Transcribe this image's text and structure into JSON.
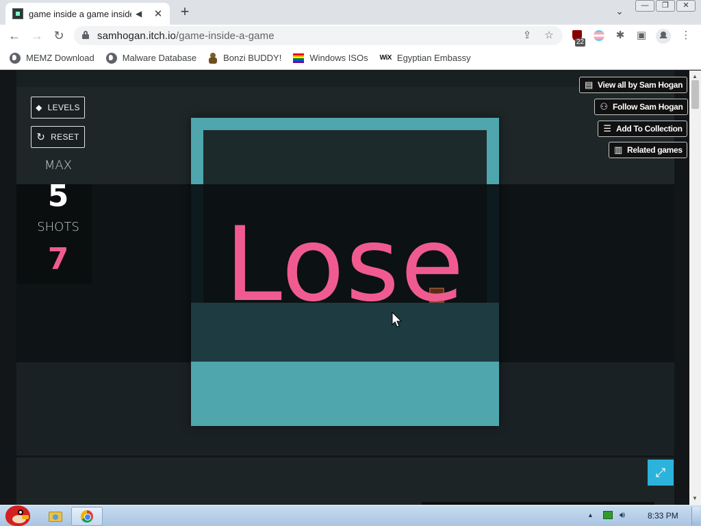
{
  "browser": {
    "tab": {
      "title": "game inside a game inside",
      "audio_icon": "speaker-icon",
      "close_label": "✕"
    },
    "new_tab_label": "+",
    "tab_search_label": "⌄",
    "window_controls": [
      "—",
      "❐",
      "✕"
    ],
    "address": {
      "domain": "samhogan.itch.io",
      "path": "/game-inside-a-game"
    },
    "extension_badge": "22",
    "bookmarks": [
      {
        "label": "MEMZ Download",
        "icon": "globe-icon"
      },
      {
        "label": "Malware Database",
        "icon": "globe-icon"
      },
      {
        "label": "Bonzi BUDDY!",
        "icon": "bonzi-icon"
      },
      {
        "label": "Windows ISOs",
        "icon": "rainbow-flag-icon"
      },
      {
        "label": "Egyptian Embassy",
        "icon": "wix-icon"
      }
    ]
  },
  "game": {
    "levels_label": "LEVELS",
    "reset_label": "RESET",
    "max_label": "MAX",
    "max_value": "5",
    "shots_label": "SHOTS",
    "shots_value": "7",
    "overlay_text": "Lose",
    "colors": {
      "teal": "#4fa6ad",
      "pink": "#f05b8f",
      "fullscreen": "#2bb3dc"
    }
  },
  "itch": {
    "view_all": "View all by Sam Hogan",
    "follow": "Follow Sam Hogan",
    "add_collection": "Add To Collection",
    "related": "Related games"
  },
  "taskbar": {
    "clock": "8:33 PM"
  }
}
